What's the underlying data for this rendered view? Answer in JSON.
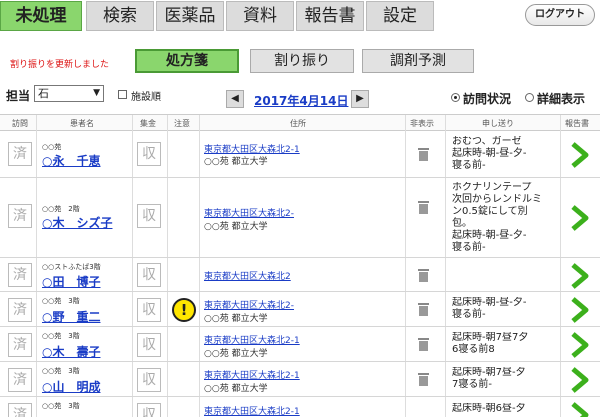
{
  "nav": {
    "tabs": [
      "未処理",
      "検索",
      "医薬品",
      "資料",
      "報告書",
      "設定"
    ],
    "logout": "ログアウト"
  },
  "notice": "割り振りを更新しました",
  "subtabs": [
    "処方箋",
    "割り振り",
    "調剤予測"
  ],
  "filter": {
    "tanto_label": "担当",
    "tanto_value": "石",
    "shisetsu_label": "施設順",
    "date": "2017年4月14日",
    "radio1": "訪問状況",
    "radio2": "詳細表示"
  },
  "headers": [
    "訪問",
    "患者名",
    "集金",
    "注意",
    "住所",
    "非表示",
    "申し送り",
    "報告書"
  ],
  "rows": [
    {
      "done": "済",
      "shu": "収",
      "small": "○○苑",
      "name": "○永　千恵",
      "addr1": "東京都大田区大森北2-1",
      "addr2": "○○苑 都立大学",
      "note": "おむつ、ガーゼ\n起床時-朝-昼-夕-\n寝る前-"
    },
    {
      "done": "済",
      "shu": "収",
      "small": "○○苑　2階",
      "name": "○木　シズ子",
      "addr1": "東京都大田区大森北2-",
      "addr2": "○○苑 都立大学",
      "note": "ホクナリンテープ\n次回からレンドルミ\nン0.5錠にして別\n包。\n起床時-朝-昼-夕-\n寝る前-"
    },
    {
      "done": "済",
      "shu": "収",
      "small": "○○ストふたば3階",
      "name": "○田　博子",
      "addr1": "東京都大田区大森北2",
      "addr2": "",
      "note": ""
    },
    {
      "done": "済",
      "shu": "収",
      "small": "○○苑　3階",
      "name": "○野　重二",
      "addr1": "東京都大田区大森北2-",
      "addr2": "○○苑 都立大学",
      "note": "起床時-朝-昼-夕-\n寝る前-",
      "warn": "!"
    },
    {
      "done": "済",
      "shu": "収",
      "small": "○○苑　3階",
      "name": "○木　壽子",
      "addr1": "東京都大田区大森北2-1",
      "addr2": "○○苑 都立大学",
      "note": "起床時-朝7昼7夕\n6寝る前8"
    },
    {
      "done": "済",
      "shu": "収",
      "small": "○○苑　3階",
      "name": "○山　明成",
      "addr1": "東京都大田区大森北2-1",
      "addr2": "○○苑 都立大学",
      "note": "起床時-朝7昼-夕\n7寝る前-"
    },
    {
      "done": "済",
      "shu": "収",
      "small": "○○苑　3階",
      "name": "",
      "addr1": "東京都大田区大森北2-1",
      "addr2": "",
      "note": "起床時-朝6昼-夕"
    }
  ]
}
